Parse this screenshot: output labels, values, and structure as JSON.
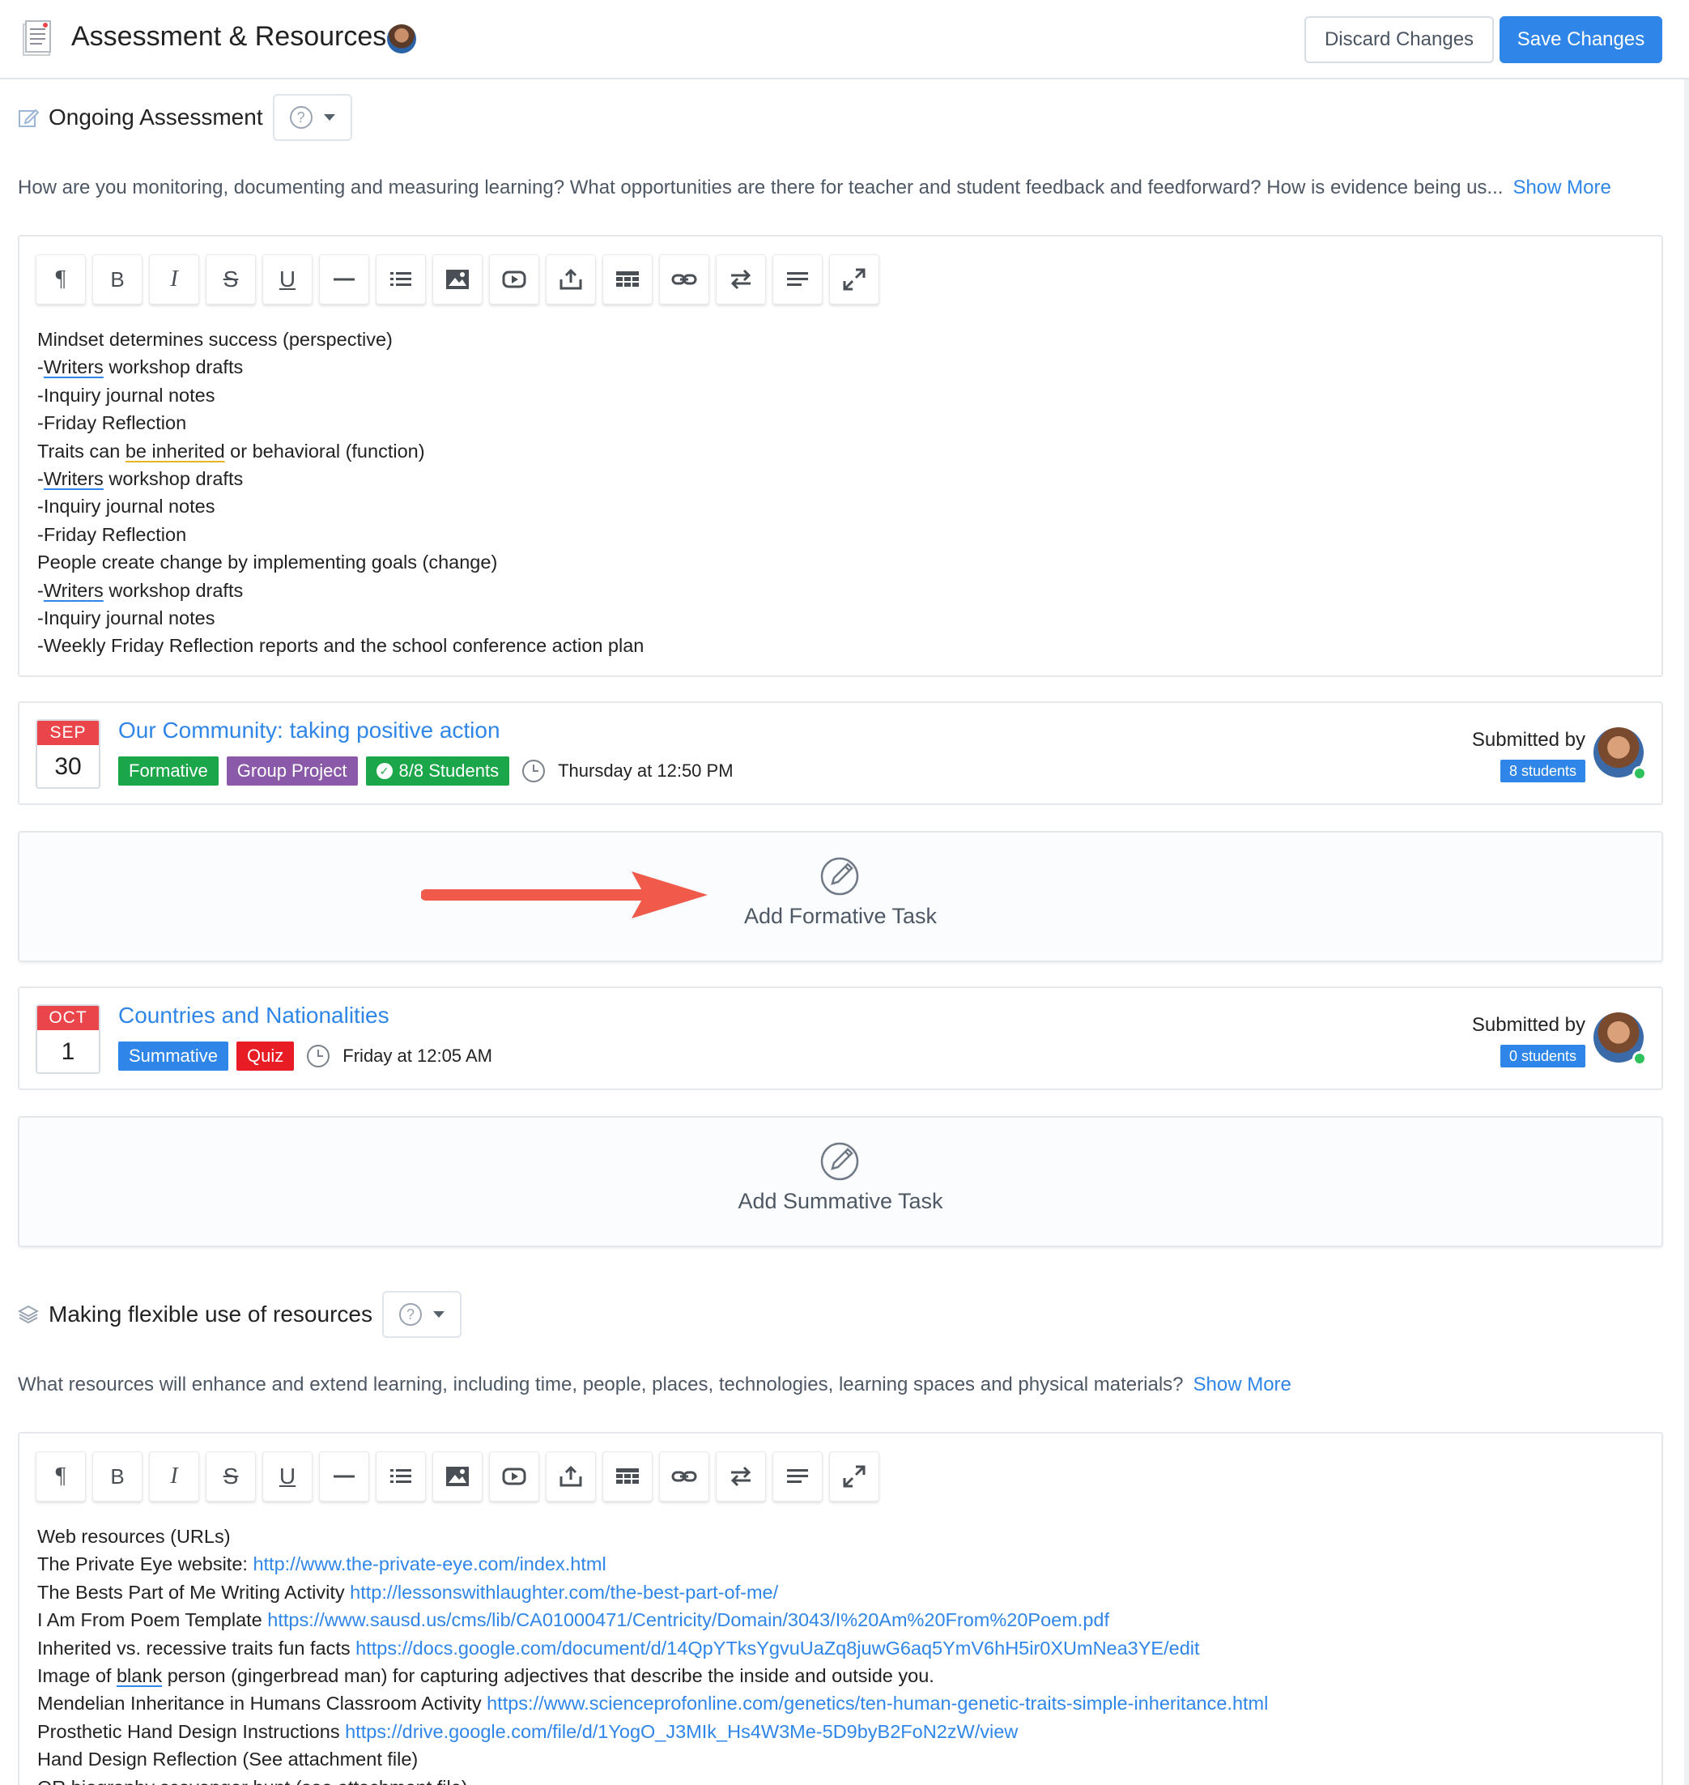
{
  "header": {
    "title": "Assessment & Resources",
    "discard_label": "Discard Changes",
    "save_label": "Save Changes"
  },
  "colors": {
    "accent": "#2f86e8",
    "formative": "#1ba64a",
    "group_project": "#8a5aa8",
    "quiz": "#e81c24",
    "calendar_red": "#e9454a",
    "annotation_arrow": "#f05a4a"
  },
  "ongoing": {
    "title": "Ongoing Assessment",
    "help_icon": "question-circle-icon",
    "prompt": "How are you monitoring, documenting and measuring learning? What opportunities are there for teacher and student feedback and feedforward? How is evidence being us...",
    "show_more": "Show More",
    "toolbar": [
      "paragraph-icon",
      "bold-icon",
      "italic-icon",
      "strikethrough-icon",
      "underline-icon",
      "horizontal-rule-icon",
      "list-icon",
      "image-icon",
      "video-icon",
      "upload-icon",
      "table-icon",
      "link-icon",
      "swap-icon",
      "align-icon",
      "expand-icon"
    ],
    "lines": [
      {
        "pre": "Mindset determines success (perspective)"
      },
      {
        "pre": "-",
        "u_blue": "Writers",
        "post": " workshop drafts"
      },
      {
        "pre": "-Inquiry journal notes"
      },
      {
        "pre": "-Friday Reflection"
      },
      {
        "pre": "Traits can ",
        "u_yellow": "be inherited",
        "post": " or behavioral (function)"
      },
      {
        "pre": "-",
        "u_blue": "Writers",
        "post": " workshop drafts"
      },
      {
        "pre": "-Inquiry journal notes"
      },
      {
        "pre": "-Friday Reflection"
      },
      {
        "pre": "People create change by implementing goals (change)"
      },
      {
        "pre": "-",
        "u_blue": "Writers",
        "post": " workshop drafts"
      },
      {
        "pre": "-Inquiry journal notes"
      },
      {
        "pre": "-Weekly Friday Reflection reports and the school conference action plan"
      }
    ]
  },
  "tasks": [
    {
      "month": "SEP",
      "day": "30",
      "title": "Our Community: taking positive action",
      "tags": [
        "Formative",
        "Group Project"
      ],
      "students_tag": "8/8 Students",
      "due": "Thursday at 12:50 PM",
      "submitted_label": "Submitted by",
      "submitted_count": "8 students"
    },
    {
      "month": "OCT",
      "day": "1",
      "title": "Countries and Nationalities",
      "tags": [
        "Summative",
        "Quiz"
      ],
      "due": "Friday at 12:05 AM",
      "submitted_label": "Submitted by",
      "submitted_count": "0 students"
    }
  ],
  "add_formative": "Add Formative Task",
  "add_summative": "Add Summative Task",
  "resources": {
    "title": "Making flexible use of resources",
    "prompt": "What resources will enhance and extend learning, including time, people, places, technologies, learning spaces and physical materials?",
    "show_more": "Show More",
    "lines": [
      {
        "pre": "Web resources (URLs)"
      },
      {
        "pre": "The Private Eye website: ",
        "link": "http://www.the-private-eye.com/index.html"
      },
      {
        "pre": "The Bests Part of Me Writing Activity ",
        "link": "http://lessonswithlaughter.com/the-best-part-of-me/"
      },
      {
        "pre": "I Am From Poem Template ",
        "link": "https://www.sausd.us/cms/lib/CA01000471/Centricity/Domain/3043/I%20Am%20From%20Poem.pdf"
      },
      {
        "pre": "Inherited vs. recessive traits fun facts ",
        "link": "https://docs.google.com/document/d/14QpYTksYgvuUaZq8juwG6aq5YmV6hH5ir0XUmNea3YE/edit"
      },
      {
        "pre": "Image of ",
        "u_blue": "blank",
        "post": " person (gingerbread man) for capturing adjectives that describe the inside and outside you."
      },
      {
        "pre": "Mendelian Inheritance in Humans Classroom Activity ",
        "link": "https://www.scienceprofonline.com/genetics/ten-human-genetic-traits-simple-inheritance.html"
      },
      {
        "pre": "Prosthetic Hand Design Instructions ",
        "link": "https://drive.google.com/file/d/1YogO_J3MIk_Hs4W3Me-5D9byB2FoN2zW/view"
      },
      {
        "pre": "Hand Design Reflection (See attachment file)"
      },
      {
        "pre": "QR biography scavenger hunt (see attachment file)"
      }
    ]
  }
}
